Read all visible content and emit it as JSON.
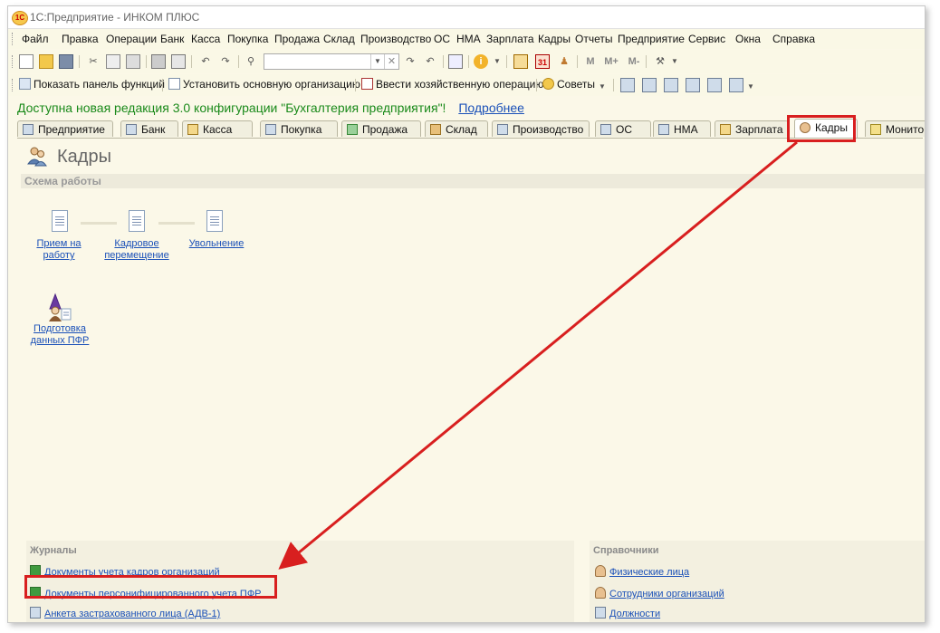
{
  "window": {
    "title": "1С:Предприятие - ИНКОМ ПЛЮС",
    "logo_text": "1С"
  },
  "menu": [
    "Файл",
    "Правка",
    "Операции",
    "Банк",
    "Касса",
    "Покупка",
    "Продажа",
    "Склад",
    "Производство",
    "ОС",
    "НМА",
    "Зарплата",
    "Кадры",
    "Отчеты",
    "Предприятие",
    "Сервис",
    "Окна",
    "Справка"
  ],
  "toolbar1": {
    "search_value": "",
    "icons": [
      "new-doc-icon",
      "open-folder-icon",
      "save-icon",
      "cut-icon",
      "copy-icon",
      "paste-icon",
      "print-icon",
      "print-preview-icon",
      "undo-icon",
      "redo-icon",
      "find-icon",
      "search-dropdown-icon",
      "search-clear-icon",
      "find-next-icon",
      "find-prev-icon",
      "window-icon",
      "info-icon",
      "calculator-icon",
      "calendar-icon",
      "users-icon",
      "memory-m-icon",
      "memory-plus-icon",
      "memory-minus-icon",
      "tools-icon"
    ],
    "m": "M",
    "mplus": "M+",
    "mminus": "M-",
    "calendar_day": "31"
  },
  "toolbar2": {
    "show_panel": "Показать панель функций",
    "set_org": "Установить основную организацию",
    "enter_op": "Ввести хозяйственную операцию",
    "tips": "Советы"
  },
  "notice": {
    "text": "Доступна новая редакция 3.0 конфигурации \"Бухгалтерия предприятия\"!",
    "link": "Подробнее"
  },
  "tabs": [
    "Предприятие",
    "Банк",
    "Касса",
    "Покупка",
    "Продажа",
    "Склад",
    "Производство",
    "ОС",
    "НМА",
    "Зарплата",
    "Кадры",
    "Монито"
  ],
  "active_tab": "Кадры",
  "page": {
    "title": "Кадры",
    "scheme_header": "Схема работы"
  },
  "scheme": {
    "hire": [
      "Прием на",
      "работу"
    ],
    "transfer": [
      "Кадровое",
      "перемещение"
    ],
    "dismissal": [
      "Увольнение"
    ],
    "pfr": [
      "Подготовка",
      "данных ПФР"
    ]
  },
  "journals": {
    "header": "Журналы",
    "items": [
      "Документы учета кадров организаций",
      "Документы персонифицированного учета ПФР",
      "Анкета застрахованного лица (АДВ-1)"
    ]
  },
  "refs": {
    "header": "Справочники",
    "items": [
      "Физические лица",
      "Сотрудники организаций",
      "Должности"
    ]
  },
  "colors": {
    "accent_red": "#d81f1f",
    "link_blue": "#1a50b8",
    "notice_green": "#1a8a1a",
    "background": "#fbf8e8"
  }
}
